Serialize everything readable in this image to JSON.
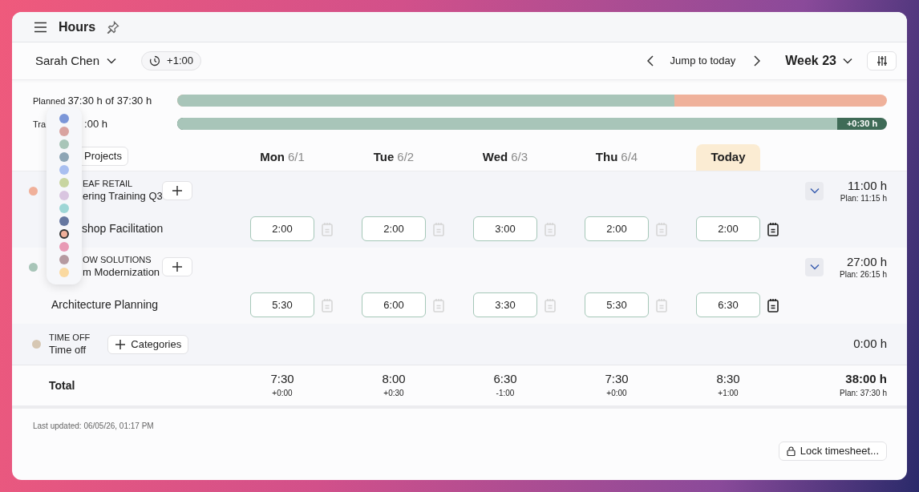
{
  "header": {
    "title": "Hours"
  },
  "toolbar": {
    "person": "Sarah Chen",
    "balance": "+1:00",
    "jump": "Jump to today",
    "week": "Week 23"
  },
  "summary": {
    "planned": {
      "label": "Planned",
      "value": "37:30 h of 37:30 h",
      "level": 0.7
    },
    "tracked": {
      "label": "Tra",
      "value": ":00 h",
      "level": 0.93,
      "overtime": "+0:30 h"
    }
  },
  "color_picker": {
    "colors": [
      {
        "color": "#7b96d8",
        "selected": false
      },
      {
        "color": "#d9a3a0",
        "selected": false
      },
      {
        "color": "#a8c5b8",
        "selected": false
      },
      {
        "color": "#8da5b5",
        "selected": false
      },
      {
        "color": "#a9bff0",
        "selected": false
      },
      {
        "color": "#c8d5a0",
        "selected": false
      },
      {
        "color": "#d9c5e0",
        "selected": false
      },
      {
        "color": "#9ed6d6",
        "selected": false
      },
      {
        "color": "#6677a0",
        "selected": false
      },
      {
        "color": "#f0b09a",
        "selected": true
      },
      {
        "color": "#e89ab5",
        "selected": false
      },
      {
        "color": "#b59aa0",
        "selected": false
      },
      {
        "color": "#fad9a0",
        "selected": false
      }
    ]
  },
  "projects_button": "Projects",
  "days": [
    {
      "day": "Mon",
      "date": "6/1",
      "today": false
    },
    {
      "day": "Tue",
      "date": "6/2",
      "today": false
    },
    {
      "day": "Wed",
      "date": "6/3",
      "today": false
    },
    {
      "day": "Thu",
      "date": "6/4",
      "today": false
    },
    {
      "day": "Today",
      "today": true
    }
  ],
  "groups": [
    {
      "color": "#f0b09a",
      "client": "EAF RETAIL",
      "project": "ering Training Q3",
      "cut": true,
      "total": "11:00 h",
      "plan": "Plan: 11:15 h",
      "tasks": [
        {
          "name": "shop Facilitation",
          "cut": true,
          "entries": [
            {
              "value": "2:00",
              "note": false
            },
            {
              "value": "2:00",
              "note": false
            },
            {
              "value": "3:00",
              "note": false
            },
            {
              "value": "2:00",
              "note": false
            },
            {
              "value": "2:00",
              "note": true
            }
          ]
        }
      ]
    },
    {
      "color": "#a8c5b8",
      "client": "OW SOLUTIONS",
      "project": "m Modernization",
      "cut": true,
      "total": "27:00 h",
      "plan": "Plan: 26:15 h",
      "tasks": [
        {
          "name": "Architecture Planning",
          "entries": [
            {
              "value": "5:30",
              "note": false
            },
            {
              "value": "6:00",
              "note": false
            },
            {
              "value": "3:30",
              "note": false
            },
            {
              "value": "5:30",
              "note": false
            },
            {
              "value": "6:30",
              "note": true
            }
          ]
        }
      ]
    }
  ],
  "time_off": {
    "color": "#d6c7b3",
    "category": "TIME OFF",
    "name": "Time off",
    "button": "Categories",
    "total": "0:00 h"
  },
  "totals": {
    "label": "Total",
    "days": [
      {
        "value": "7:30",
        "diff": "+0:00"
      },
      {
        "value": "8:00",
        "diff": "+0:30"
      },
      {
        "value": "6:30",
        "diff": "-1:00"
      },
      {
        "value": "7:30",
        "diff": "+0:00"
      },
      {
        "value": "8:30",
        "diff": "+1:00"
      }
    ],
    "total": "38:00 h",
    "plan": "Plan: 37:30 h"
  },
  "footer": {
    "updated": "Last updated: 06/05/26, 01:17 PM",
    "lock": "Lock timesheet..."
  }
}
